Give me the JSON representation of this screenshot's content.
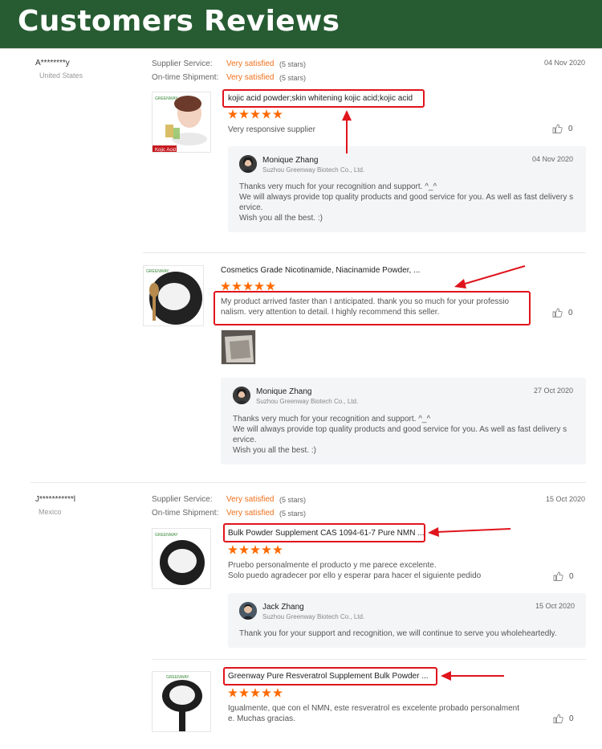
{
  "banner": {
    "title": "Customers Reviews"
  },
  "labels": {
    "supplier_service": "Supplier Service:",
    "ontime_shipment": "On-time Shipment:"
  },
  "reviews": [
    {
      "reviewer": "A********y",
      "country": "United States",
      "supplier_service": "Very satisfied",
      "supplier_stars": "(5 stars)",
      "ontime": "Very satisfied",
      "ontime_stars": "(5 stars)",
      "date": "04 Nov 2020",
      "items": [
        {
          "title": "kojic acid powder;skin whitening kojic acid;kojic acid",
          "rating": 5,
          "comment": [
            "Very responsive supplier"
          ],
          "likes": "0",
          "thumb_label": "Kojic Acid",
          "reply": {
            "name": "Monique Zhang",
            "company": "Suzhou Greenway Biotech Co., Ltd.",
            "date": "04 Nov 2020",
            "text": [
              "Thanks very much for your recognition and support. ^_^",
              "We will always provide top quality products and good service for you. As well as fast delivery s",
              "ervice.",
              "Wish you all the best. :)"
            ]
          }
        },
        {
          "title": "Cosmetics Grade Nicotinamide, Niacinamide Powder, ...",
          "rating": 5,
          "comment": [
            "My product arrived faster than I anticipated. thank you so much for your professio",
            "nalism. very attention to detail.  I highly recommend this seller."
          ],
          "likes": "0",
          "reply": {
            "name": "Monique Zhang",
            "company": "Suzhou Greenway Biotech Co., Ltd.",
            "date": "27 Oct 2020",
            "text": [
              "Thanks very much for your recognition and support. ^_^",
              "We will always provide top quality products and good service for you. As well as fast delivery s",
              "ervice.",
              "Wish you all the best. :)"
            ]
          }
        }
      ]
    },
    {
      "reviewer": "J***********l",
      "country": "Mexico",
      "supplier_service": "Very satisfied",
      "supplier_stars": "(5 stars)",
      "ontime": "Very satisfied",
      "ontime_stars": "(5 stars)",
      "date": "15 Oct 2020",
      "items": [
        {
          "title": "Bulk Powder Supplement CAS 1094-61-7 Pure NMN ...",
          "rating": 5,
          "comment": [
            "Pruebo personalmente el producto y me parece excelente.",
            "Solo puedo agradecer por ello y esperar para hacer el siguiente pedido"
          ],
          "likes": "0",
          "reply": {
            "name": "Jack Zhang",
            "company": "Suzhou Greenway Biotech Co., Ltd.",
            "date": "15 Oct 2020",
            "text": [
              "Thank you for your support and recognition, we will continue to serve you wholeheartedly."
            ]
          }
        },
        {
          "title": "Greenway Pure Resveratrol Supplement Bulk Powder ...",
          "rating": 5,
          "comment": [
            "Igualmente, que con el NMN, este resveratrol es excelente probado personalment",
            "e. Muchas gracias."
          ],
          "likes": "0"
        }
      ]
    }
  ],
  "colors": {
    "banner": "#275c33",
    "accent": "#f0701b",
    "star": "#ff6a00",
    "highlight": "#e0141c"
  }
}
